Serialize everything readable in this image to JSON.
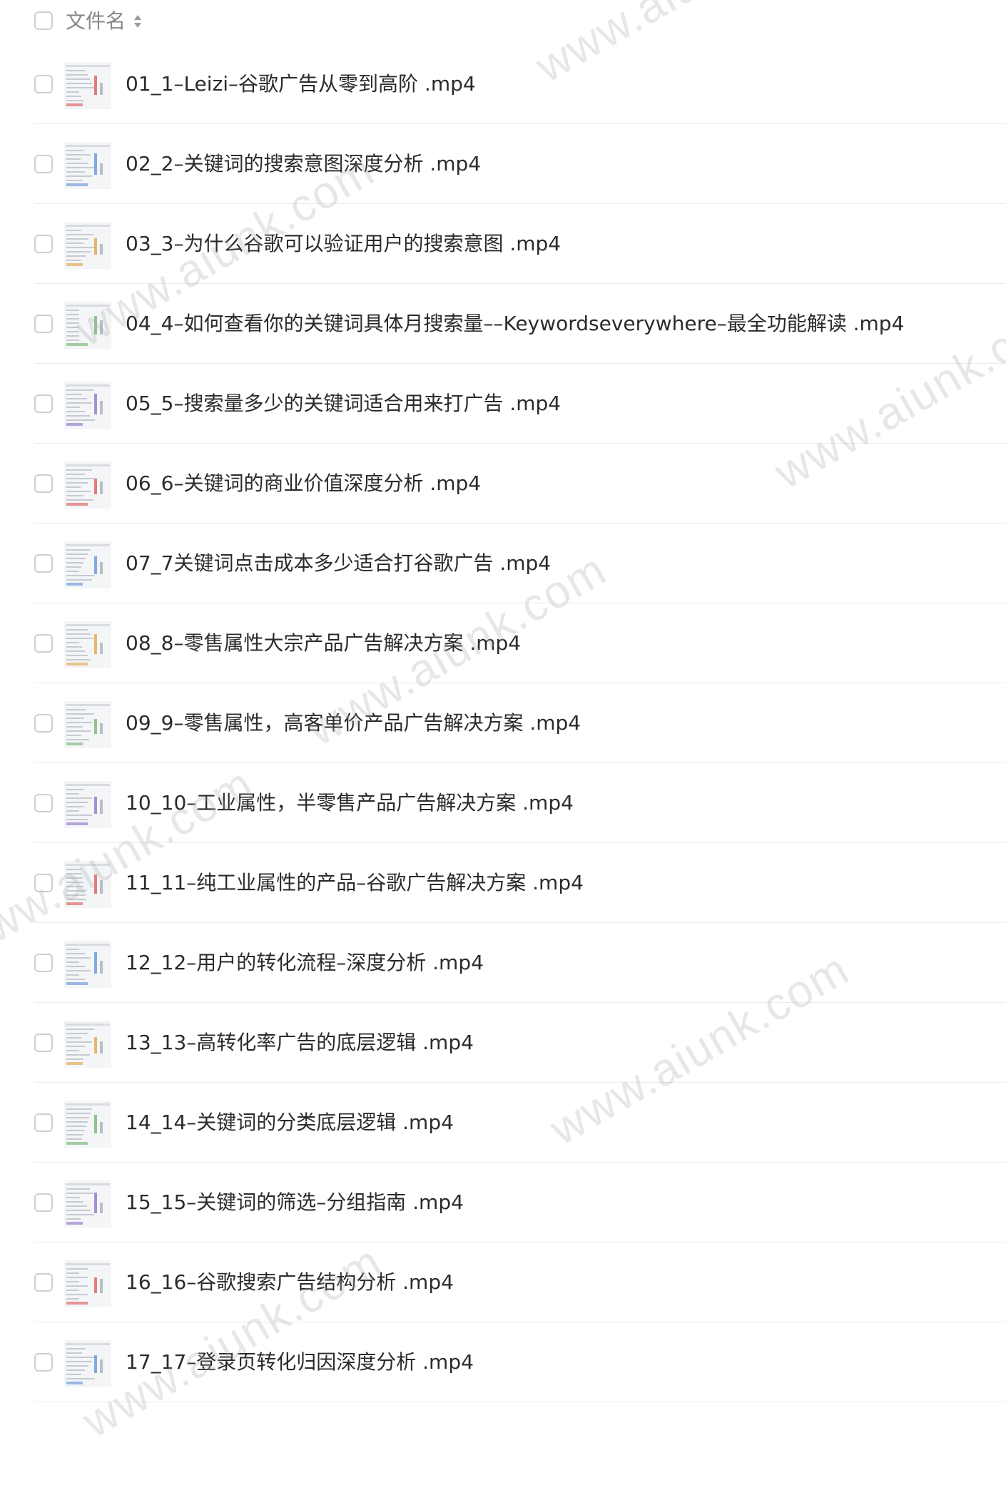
{
  "header": {
    "label": "文件名",
    "sort_icon": "sort-icon"
  },
  "files": [
    {
      "name": "01_1–Leizi–谷歌广告从零到高阶 .mp4"
    },
    {
      "name": "02_2–关键词的搜索意图深度分析 .mp4"
    },
    {
      "name": "03_3–为什么谷歌可以验证用户的搜索意图 .mp4"
    },
    {
      "name": "04_4–如何查看你的关键词具体月搜索量––Keywordseverywhere–最全功能解读 .mp4"
    },
    {
      "name": "05_5–搜索量多少的关键词适合用来打广告 .mp4"
    },
    {
      "name": "06_6–关键词的商业价值深度分析 .mp4"
    },
    {
      "name": "07_7关键词点击成本多少适合打谷歌广告 .mp4"
    },
    {
      "name": "08_8–零售属性大宗产品广告解决方案 .mp4"
    },
    {
      "name": "09_9–零售属性，高客单价产品广告解决方案 .mp4"
    },
    {
      "name": "10_10–工业属性，半零售产品广告解决方案 .mp4"
    },
    {
      "name": "11_11–纯工业属性的产品–谷歌广告解决方案 .mp4"
    },
    {
      "name": "12_12–用户的转化流程–深度分析 .mp4"
    },
    {
      "name": "13_13–高转化率广告的底层逻辑 .mp4"
    },
    {
      "name": "14_14–关键词的分类底层逻辑 .mp4"
    },
    {
      "name": "15_15–关键词的筛选–分组指南 .mp4"
    },
    {
      "name": "16_16–谷歌搜索广告结构分析 .mp4"
    },
    {
      "name": "17_17–登录页转化归因深度分析 .mp4"
    }
  ],
  "watermarks": [
    {
      "text": "www.aiunk.com"
    },
    {
      "text": "www.aiunk.com"
    },
    {
      "text": "www.aiunk.com"
    },
    {
      "text": "www.aiunk.com"
    },
    {
      "text": "www.aiunk.com"
    },
    {
      "text": "www.aiunk.com"
    },
    {
      "text": "www.aiunk.com"
    }
  ]
}
